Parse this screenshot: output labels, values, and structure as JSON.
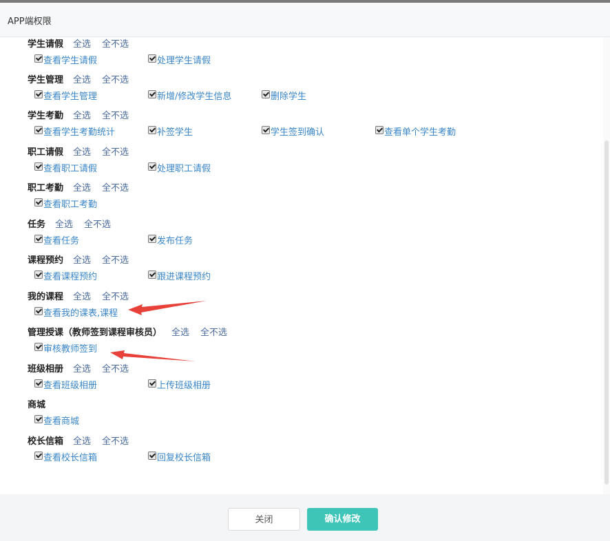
{
  "dialog": {
    "title": "APP端权限"
  },
  "groups": [
    {
      "name": "学生请假",
      "select_all": "全选",
      "select_none": "全不选",
      "items": [
        "查看学生请假",
        "处理学生请假"
      ]
    },
    {
      "name": "学生管理",
      "select_all": "全选",
      "select_none": "全不选",
      "items": [
        "查看学生管理",
        "新增/修改学生信息",
        "删除学生"
      ]
    },
    {
      "name": "学生考勤",
      "select_all": "全选",
      "select_none": "全不选",
      "items": [
        "查看学生考勤统计",
        "补签学生",
        "学生签到确认",
        "查看单个学生考勤"
      ]
    },
    {
      "name": "职工请假",
      "select_all": "全选",
      "select_none": "全不选",
      "items": [
        "查看职工请假",
        "处理职工请假"
      ]
    },
    {
      "name": "职工考勤",
      "select_all": "全选",
      "select_none": "全不选",
      "items": [
        "查看职工考勤"
      ]
    },
    {
      "name": "任务",
      "select_all": "全选",
      "select_none": "全不选",
      "items": [
        "查看任务",
        "发布任务"
      ]
    },
    {
      "name": "课程预约",
      "select_all": "全选",
      "select_none": "全不选",
      "items": [
        "查看课程预约",
        "跟进课程预约"
      ]
    },
    {
      "name": "我的课程",
      "select_all": "全选",
      "select_none": "全不选",
      "items": [
        "查看我的课表,课程"
      ]
    },
    {
      "name": "管理授课（教师签到课程审核员）",
      "select_all": "全选",
      "select_none": "全不选",
      "items": [
        "审核教师签到"
      ]
    },
    {
      "name": "班级相册",
      "select_all": "全选",
      "select_none": "全不选",
      "items": [
        "查看班级相册",
        "上传班级相册"
      ]
    },
    {
      "name": "商城",
      "items": [
        "查看商城"
      ]
    },
    {
      "name": "校长信箱",
      "select_all": "全选",
      "select_none": "全不选",
      "items": [
        "查看校长信箱",
        "回复校长信箱"
      ]
    }
  ],
  "all_items_checked": true,
  "footer": {
    "close_label": "关闭",
    "confirm_label": "确认修改"
  },
  "colors": {
    "accent": "#3ec5b8",
    "link": "#4a6a9c",
    "item_text": "#3a86c8",
    "arrow": "#e8413a"
  }
}
